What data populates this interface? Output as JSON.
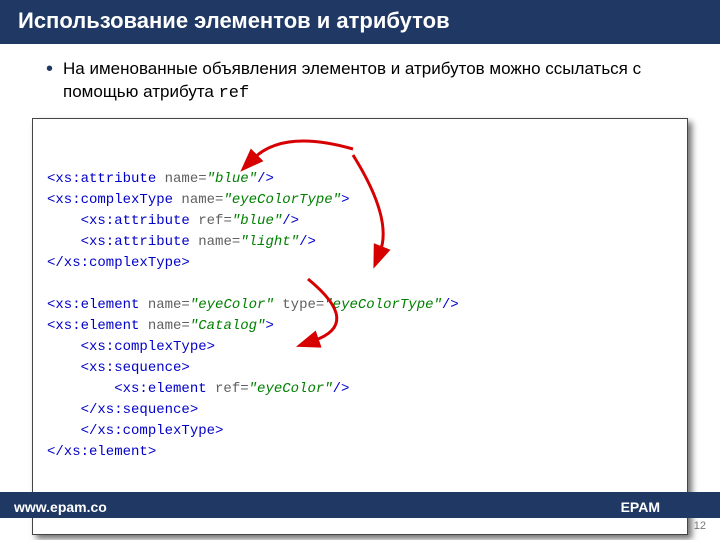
{
  "title": "Использование элементов и атрибутов",
  "bullet": {
    "text": "На именованные объявления элементов и атрибутов можно ссылаться с помощью атрибута ",
    "code": "ref"
  },
  "code": {
    "lines": [
      [
        {
          "t": "<xs:attribute ",
          "c": "tag"
        },
        {
          "t": "name=",
          "c": "attr"
        },
        {
          "t": "\"blue\"",
          "c": "val"
        },
        {
          "t": "/>",
          "c": "tag"
        }
      ],
      [
        {
          "t": "<xs:complexType ",
          "c": "tag"
        },
        {
          "t": "name=",
          "c": "attr"
        },
        {
          "t": "\"eyeColorType\"",
          "c": "val"
        },
        {
          "t": ">",
          "c": "tag"
        }
      ],
      [
        {
          "t": "    <xs:attribute ",
          "c": "tag"
        },
        {
          "t": "ref=",
          "c": "attr"
        },
        {
          "t": "\"blue\"",
          "c": "val"
        },
        {
          "t": "/>",
          "c": "tag"
        }
      ],
      [
        {
          "t": "    <xs:attribute ",
          "c": "tag"
        },
        {
          "t": "name=",
          "c": "attr"
        },
        {
          "t": "\"light\"",
          "c": "val"
        },
        {
          "t": "/>",
          "c": "tag"
        }
      ],
      [
        {
          "t": "</xs:complexType>",
          "c": "tag"
        }
      ],
      [],
      [
        {
          "t": "<xs:element ",
          "c": "tag"
        },
        {
          "t": "name=",
          "c": "attr"
        },
        {
          "t": "\"eyeColor\" ",
          "c": "val"
        },
        {
          "t": "type=",
          "c": "attr"
        },
        {
          "t": "\"eyeColorType\"",
          "c": "val"
        },
        {
          "t": "/>",
          "c": "tag"
        }
      ],
      [
        {
          "t": "<xs:element ",
          "c": "tag"
        },
        {
          "t": "name=",
          "c": "attr"
        },
        {
          "t": "\"Catalog\"",
          "c": "val"
        },
        {
          "t": ">",
          "c": "tag"
        }
      ],
      [
        {
          "t": "    <xs:complexType>",
          "c": "tag"
        }
      ],
      [
        {
          "t": "    <xs:sequence>",
          "c": "tag"
        }
      ],
      [
        {
          "t": "        <xs:element ",
          "c": "tag"
        },
        {
          "t": "ref=",
          "c": "attr"
        },
        {
          "t": "\"eyeColor\"",
          "c": "val"
        },
        {
          "t": "/>",
          "c": "tag"
        }
      ],
      [
        {
          "t": "    </xs:sequence>",
          "c": "tag"
        }
      ],
      [
        {
          "t": "    </xs:complexType>",
          "c": "tag"
        }
      ],
      [
        {
          "t": "</xs:element>",
          "c": "tag"
        }
      ]
    ]
  },
  "footer": {
    "url": "www.epam.co",
    "brand": "EPAM"
  },
  "page_number": "12"
}
